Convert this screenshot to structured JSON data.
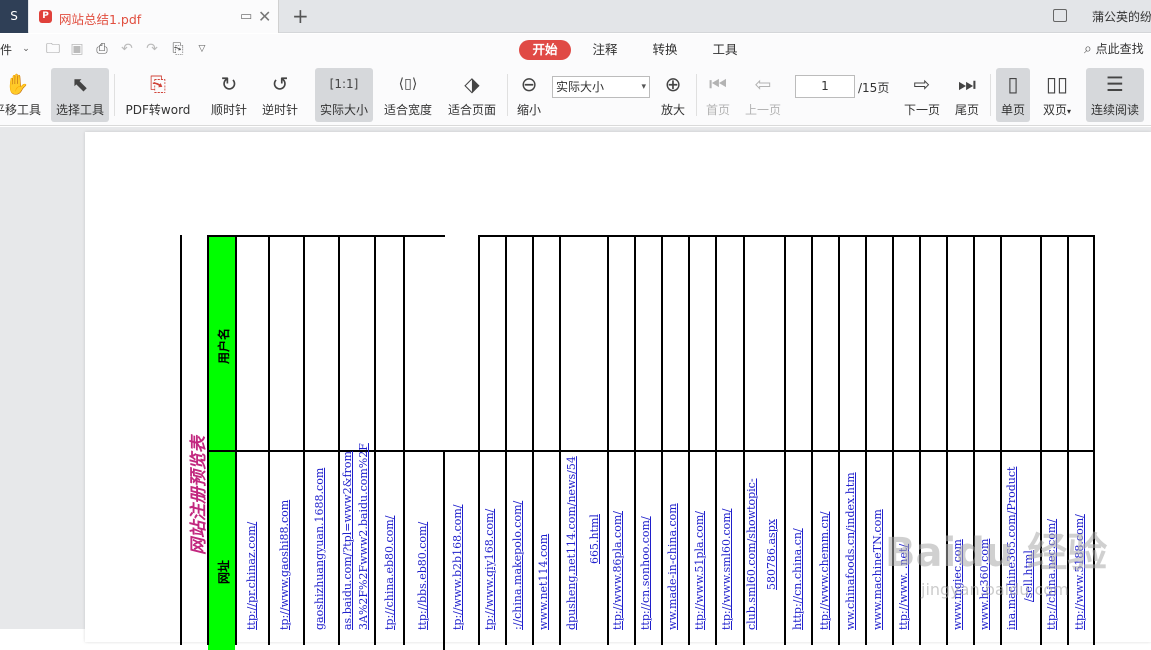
{
  "tabs": {
    "app_label": "S",
    "doc_title": "网站总结1.pdf",
    "new_tab": "+",
    "user": "蒲公英的纷"
  },
  "menu": {
    "file": "件",
    "tabs": [
      "开始",
      "注释",
      "转换",
      "工具"
    ],
    "active_tab": "开始",
    "search": "点此查找"
  },
  "toolbar": {
    "pan": "平移工具",
    "select": "选择工具",
    "pdf2word": "PDF转word",
    "rotate_cw": "顺时针",
    "rotate_ccw": "逆时针",
    "actual_size": "实际大小",
    "fit_width": "适合宽度",
    "fit_page": "适合页面",
    "zoom_out": "缩小",
    "zoom_value": "实际大小",
    "zoom_in": "放大",
    "first_page": "首页",
    "prev_page": "上一页",
    "current_page": "1",
    "total_pages": "/15页",
    "next_page": "下一页",
    "last_page": "尾页",
    "single_page": "单页",
    "double_page": "双页",
    "continuous": "连续阅读"
  },
  "document": {
    "title": "网站注册预览表",
    "header_url": "网址",
    "header_user": "用户名",
    "urls": [
      "ttp://pr.chinaz.com/",
      "tp://www.gaoshi88.com",
      "gaoshizhuangyuan.1688.com",
      "as.baidu.com/?tpl=www2&from",
      "3A%2F%2Fwww2.baidu.com%2F",
      "tp://china.eb80.com/",
      "ttp://bbs.eb80.com/",
      "tp://www.b2b168.com/",
      "tp://www.qiy168.com/",
      "://china.makepolo.com/",
      "www.net114.com",
      "dpusheng.net114.com/news/54",
      "665.html",
      "ttp://www.86pla.com/",
      "ttp://cn.sonhoo.com/",
      "ww.made-in-china.com",
      "ttp://www.51pla.com/",
      "ttp://www.sml60.com/",
      "club.sml60.com/showtopic-",
      "580786.aspx",
      "http://cn.china.cn/",
      "ttp://www.chemm.cn/",
      "ww.chinafoods.cn/index.htm",
      "www.machineTN.com",
      "ttp://www.    .net/",
      "www.mgiec.com",
      "www.hc360.com",
      "ina.machine365.com/Product",
      "/sell.html",
      "ttp://china.nec.com/",
      "ttp://www.5188.com/"
    ]
  },
  "watermark": {
    "brand": "Baidu 经验",
    "url": "jingyan.baidu.com"
  }
}
